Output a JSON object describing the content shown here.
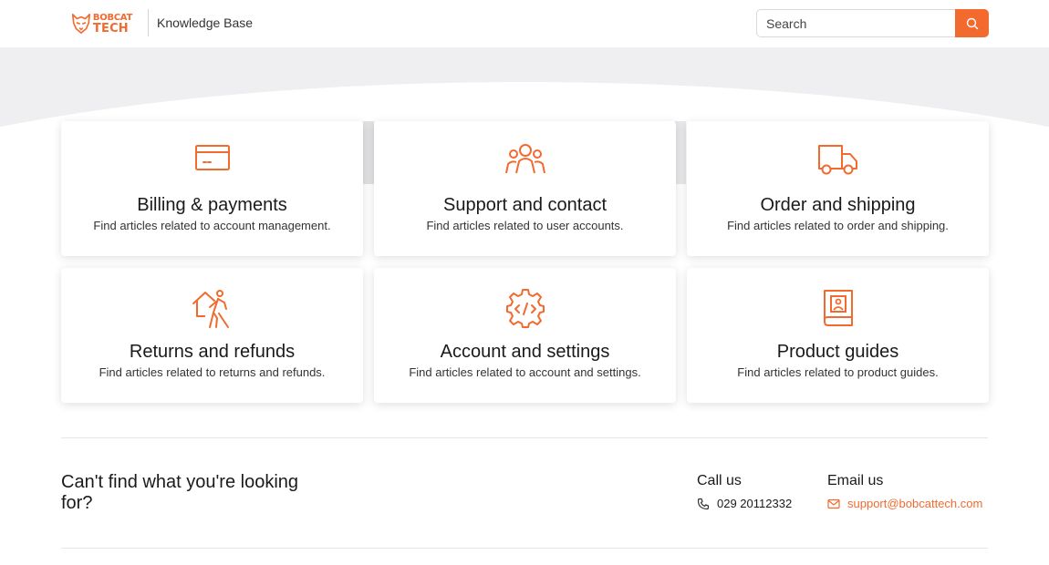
{
  "header": {
    "logo": {
      "line1": "BOBCAT",
      "line2": "TECH"
    },
    "title": "Knowledge Base",
    "search": {
      "placeholder": "Search"
    }
  },
  "categories": [
    {
      "title": "Billing & payments",
      "description": "Find articles related to account management.",
      "icon": "credit-card-icon"
    },
    {
      "title": "Support and contact",
      "description": "Find articles related to user accounts.",
      "icon": "users-group-icon"
    },
    {
      "title": "Order and shipping",
      "description": "Find articles related to order and shipping.",
      "icon": "delivery-truck-icon"
    },
    {
      "title": "Returns and refunds",
      "description": "Find articles related to returns and refunds.",
      "icon": "person-leaving-house-icon"
    },
    {
      "title": "Account and settings",
      "description": "Find articles related to account and settings.",
      "icon": "code-gear-icon"
    },
    {
      "title": "Product guides",
      "description": "Find articles related to product guides.",
      "icon": "guide-book-icon"
    }
  ],
  "footer": {
    "cant_find": "Can't find what you're looking for?",
    "call": {
      "title": "Call us",
      "phone": "029 20112332"
    },
    "email": {
      "title": "Email us",
      "address": "support@bobcattech.com"
    }
  },
  "colors": {
    "accent": "#f26a2e",
    "hero_bg": "#efeff1"
  }
}
